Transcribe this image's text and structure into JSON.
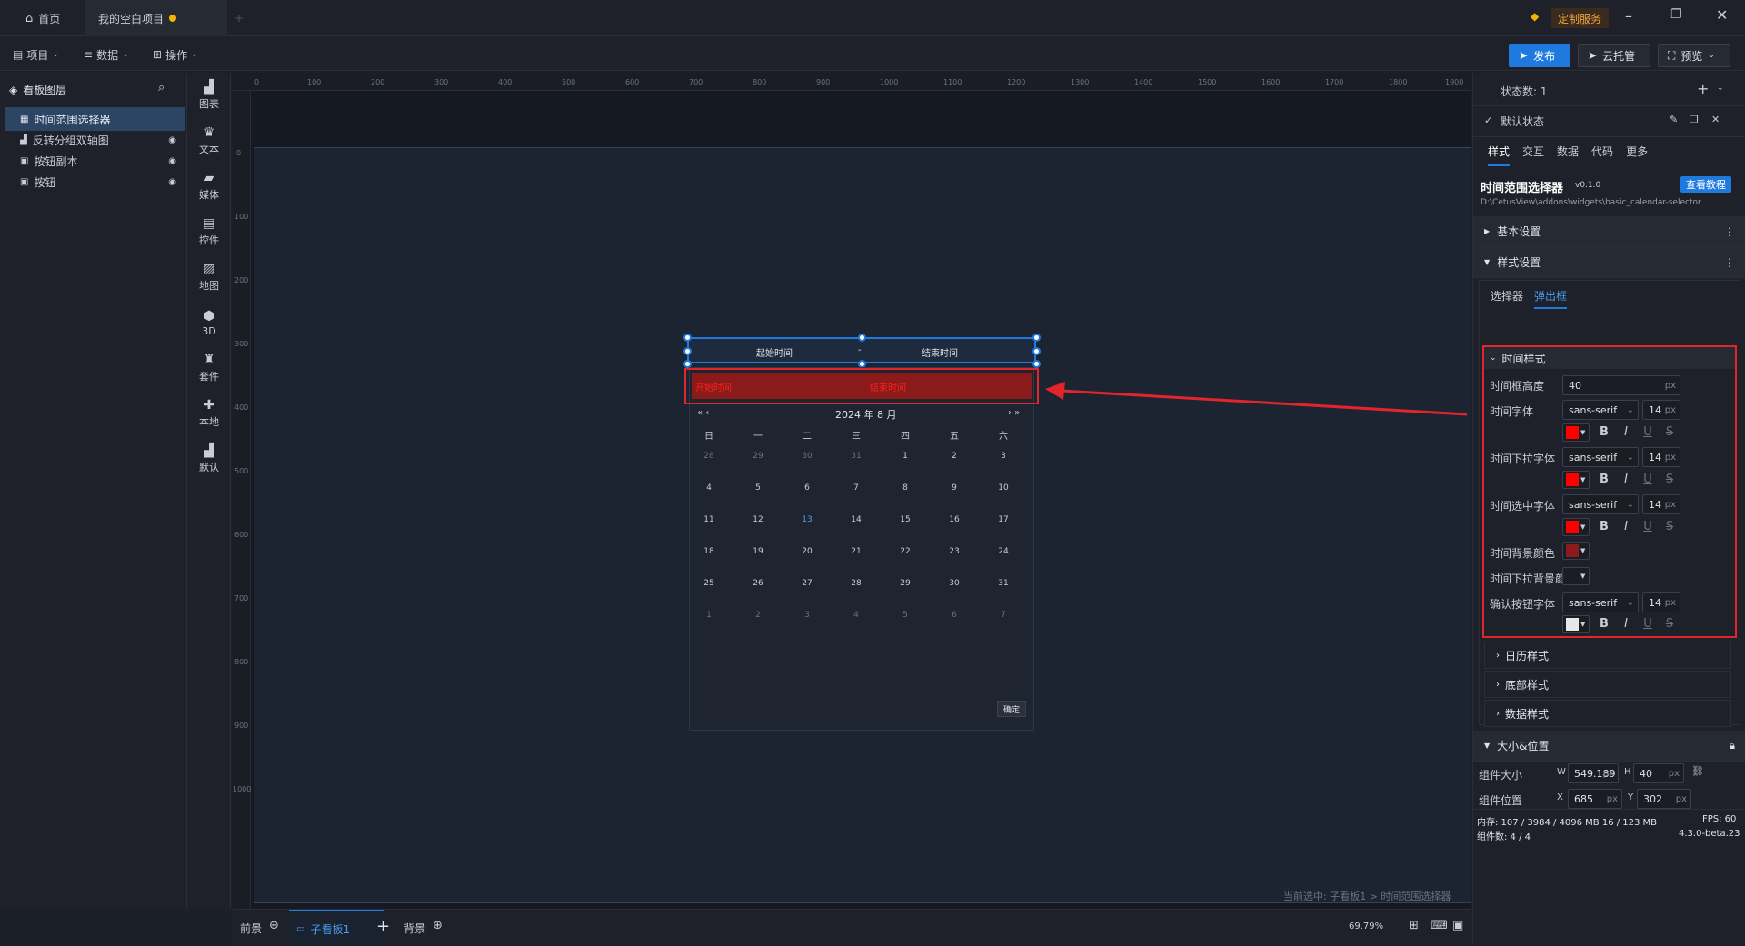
{
  "titlebar": {
    "home_tab": "首页",
    "project_tab": "我的空白项目",
    "custom_service": "定制服务"
  },
  "toolbar": {
    "menu_project": "项目",
    "menu_data": "数据",
    "menu_ops": "操作",
    "publish": "发布",
    "cloud": "云托管",
    "preview": "预览"
  },
  "layers": {
    "title": "看板图层",
    "items": [
      {
        "label": "时间范围选择器",
        "selected": true
      },
      {
        "label": "反转分组双轴图",
        "selected": false
      },
      {
        "label": "按钮副本",
        "selected": false
      },
      {
        "label": "按钮",
        "selected": false
      }
    ]
  },
  "components": [
    "图表",
    "文本",
    "媒体",
    "控件",
    "地图",
    "3D",
    "套件",
    "本地",
    "默认"
  ],
  "ruler": {
    "top_ticks": [
      "0",
      "100",
      "200",
      "300",
      "400",
      "500",
      "600",
      "700",
      "800",
      "900",
      "1000",
      "1100",
      "1200",
      "1300",
      "1400",
      "1500",
      "1600",
      "1700",
      "1800",
      "1900"
    ],
    "left_ticks": [
      "0",
      "100",
      "200",
      "300",
      "400",
      "500",
      "600",
      "700",
      "800",
      "900",
      "1000"
    ]
  },
  "widget": {
    "start_placeholder": "起始时间",
    "separator": "-",
    "end_placeholder": "结束时间",
    "dropdown_start": "开始时间",
    "dropdown_end": "结束时间",
    "month_label": "2024 年 8 月",
    "prev_nav": "« ‹",
    "next_nav": "› »",
    "weekdays": [
      "日",
      "一",
      "二",
      "三",
      "四",
      "五",
      "六"
    ],
    "weeks": [
      [
        "28",
        "29",
        "30",
        "31",
        "1",
        "2",
        "3"
      ],
      [
        "4",
        "5",
        "6",
        "7",
        "8",
        "9",
        "10"
      ],
      [
        "11",
        "12",
        "13",
        "14",
        "15",
        "16",
        "17"
      ],
      [
        "18",
        "19",
        "20",
        "21",
        "22",
        "23",
        "24"
      ],
      [
        "25",
        "26",
        "27",
        "28",
        "29",
        "30",
        "31"
      ],
      [
        "1",
        "2",
        "3",
        "4",
        "5",
        "6",
        "7"
      ]
    ],
    "today": "13",
    "confirm": "确定"
  },
  "canvas": {
    "breadcrumb": "当前选中: 子看板1 > 时间范围选择器"
  },
  "bottombar": {
    "front": "前景",
    "sub_board": "子看板1",
    "background": "背景",
    "zoom": "69.79%"
  },
  "rightpanel": {
    "state_count": "状态数: 1",
    "default_state": "默认状态",
    "tabs": [
      "样式",
      "交互",
      "数据",
      "代码",
      "更多"
    ],
    "widget_name": "时间范围选择器",
    "version": "v0.1.0",
    "tutorial": "查看教程",
    "path": "D:\\CetusView\\addons\\widgets\\basic_calendar-selector",
    "basic_settings": "基本设置",
    "style_settings": "样式设置",
    "subtabs": [
      "选择器",
      "弹出框"
    ],
    "time_style": "时间样式",
    "fields": {
      "box_height_label": "时间框高度",
      "box_height_value": "40",
      "font_label": "时间字体",
      "dropdown_font_label": "时间下拉字体",
      "selected_font_label": "时间选中字体",
      "bg_color_label": "时间背景颜色",
      "dropdown_bg_label": "时间下拉背景颜色",
      "confirm_font_label": "确认按钮字体",
      "font_family": "sans-serif",
      "font_size": "14",
      "unit": "px"
    },
    "colors": {
      "font": "#ff0000",
      "dropdown_font": "#ff0000",
      "selected_font": "#ff0000",
      "bg": "#8b1a1a",
      "dropdown_bg": "#1a1d24",
      "confirm_font": "#e8e8e8"
    },
    "calendar_style": "日历样式",
    "footer_style": "底部样式",
    "data_style": "数据样式",
    "size_position": "大小&位置",
    "size_label": "组件大小",
    "w_label": "W",
    "w_value": "549.189",
    "h_label": "H",
    "h_value": "40",
    "pos_label": "组件位置",
    "x_label": "X",
    "x_value": "685",
    "y_label": "Y",
    "y_value": "302",
    "memory": "内存: 107 / 3984 / 4096 MB 16 / 123 MB",
    "fps": "FPS: 60",
    "component_count": "组件数: 4 / 4",
    "app_version": "4.3.0-beta.23"
  },
  "accent_color": "#1f7ae0",
  "highlight_color": "#e0252b"
}
